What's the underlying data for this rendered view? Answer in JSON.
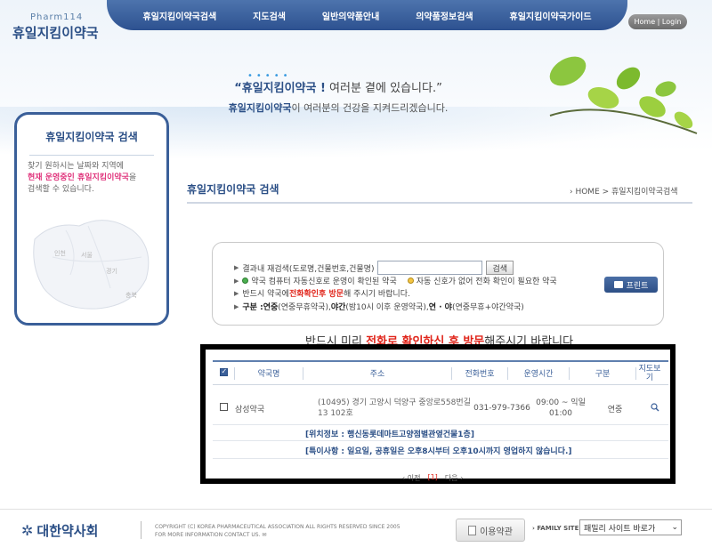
{
  "header": {
    "logo_small": "Pharm114",
    "logo_main": "휴일지킴이약국",
    "home_login": "Home | Login",
    "nav": [
      "휴일지킴이약국검색",
      "지도검색",
      "일반의약품안내",
      "의약품정보검색",
      "휴일지킴이약국가이드"
    ]
  },
  "slogan": {
    "line1_bold": "“휴일지킴이약국 !",
    "line1_rest": " 여러분 곁에 있습니다.”",
    "line2_bold": "휴일지킴이약국",
    "line2_rest": "이 여러분의 건강을 지켜드리겠습니다."
  },
  "sidebar": {
    "title": "휴일지킴이약국 검색",
    "desc_1": "찾기 원하시는 날짜와 지역에",
    "desc_pink": "현재 운영중인 휴일지킴이약국",
    "desc_2": "을",
    "desc_3": "검색할 수 있습니다.",
    "map_labels": [
      "인천",
      "서울",
      "경기",
      "충북"
    ]
  },
  "content": {
    "title": "휴일지킴이약국 검색",
    "breadcrumb": "› HOME > 휴일지킴이약국검색"
  },
  "search": {
    "label": "결과내 재검색(도로명,건물번호,건물명)",
    "input_value": "",
    "button": "검색",
    "legend_green": "약국 컴퓨터 자동신호로 운영이 확인된 약국",
    "legend_yellow": "자동 신호가 없어 전화 확인이 필요한 약국",
    "notice_pre": "반드시 약국에 ",
    "notice_red": "전화확인후 방문",
    "notice_post": "해 주시기 바랍니다.",
    "type_label": "구분 : ",
    "type_1": "연중",
    "type_1_desc": "(연중무휴약국), ",
    "type_2": "야간",
    "type_2_desc": "(밤10시 이후 운영약국), ",
    "type_3": "연 · 야",
    "type_3_desc": "(연중무휴+야간약국)",
    "print_button": "프린트"
  },
  "notice_banner": {
    "pre": "반드시 미리 ",
    "red": "전화로 확인하신 후 방문",
    "post": "해주시기 바랍니다"
  },
  "table": {
    "headers": [
      "약국명",
      "주소",
      "전화번호",
      "운영시간",
      "구분",
      "지도보기"
    ],
    "rows": [
      {
        "name": "삼성약국",
        "address": "(10495) 경기 고양시 덕양구 중앙로558번길 13 102호",
        "phone": "031-979-7366",
        "hours": "09:00 ~ 익일 01:00",
        "type": "연중"
      }
    ],
    "location_info": "[위치정보 : 행신동롯데마트고양점별관옆건물1층]",
    "special_note": "[특이사항 : 일요일, 공휴일은 오후8시부터 오후10시까지 영업하지 않습니다.]"
  },
  "pager": {
    "prev": "‹ 이전",
    "current": "[1]",
    "next": "다음 ›"
  },
  "footer": {
    "logo": "대한약사회",
    "copyright_1": "COPYRIGHT (C) KOREA PHARMACEUTICAL ASSOCIATION ALL RIGHTS RESERVED SINCE 2005",
    "copyright_2": "FOR MORE INFORMATION CONTACT US.",
    "terms_button": "이용약관",
    "family_label": "› FAMILY SITE",
    "family_select": "패밀리 사이트 바로가"
  },
  "colors": {
    "brand_blue": "#2b4f86",
    "accent_red": "#e0251b",
    "accent_pink": "#e0347c"
  }
}
